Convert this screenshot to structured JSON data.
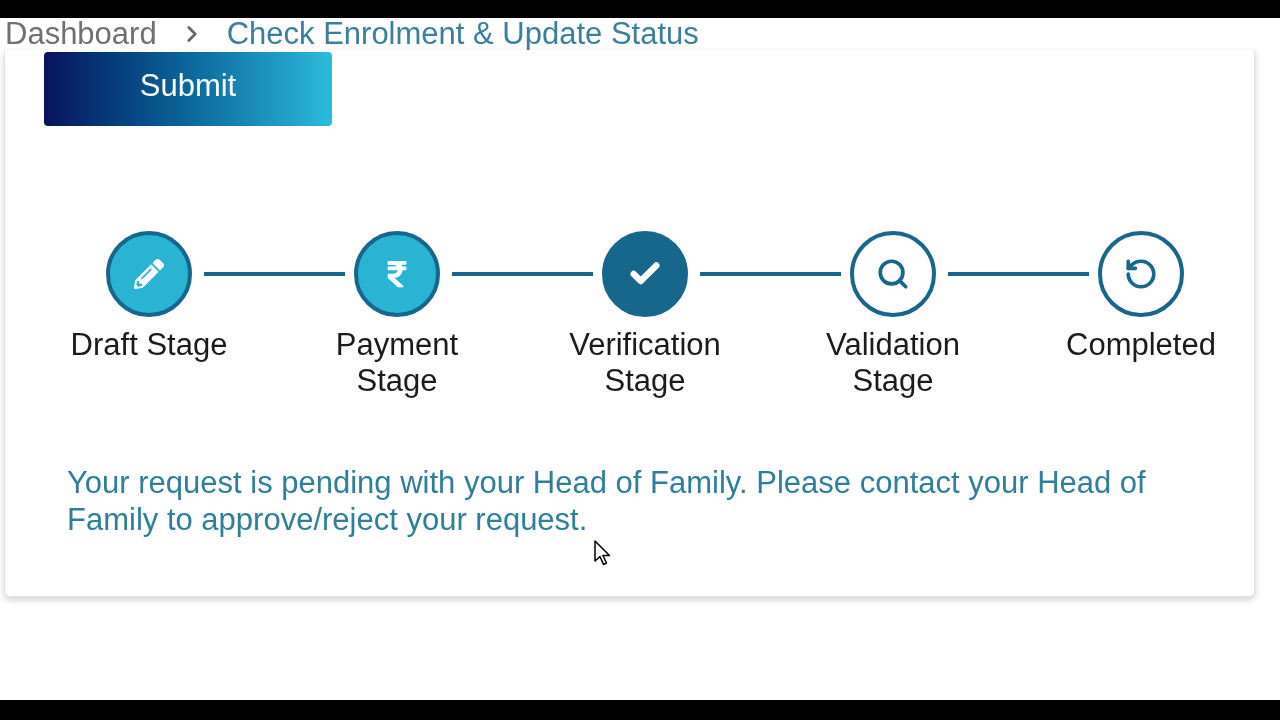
{
  "breadcrumb": [
    {
      "label": "Dashboard",
      "current": false
    },
    {
      "label": "Check Enrolment & Update Status",
      "current": true
    }
  ],
  "submit_button": {
    "label": "Submit"
  },
  "steps": [
    {
      "label": "Draft Stage",
      "completed": true,
      "selected": false
    },
    {
      "label": "Payment Stage",
      "completed": true,
      "selected": false
    },
    {
      "label": "Verification Stage",
      "completed": false,
      "selected": true
    },
    {
      "label": "Validation Stage",
      "completed": false,
      "selected": false
    },
    {
      "label": "Completed",
      "completed": false,
      "selected": false
    }
  ],
  "message": "Your request is pending with your Head of Family. Please contact your Head of Family to approve/reject your request."
}
